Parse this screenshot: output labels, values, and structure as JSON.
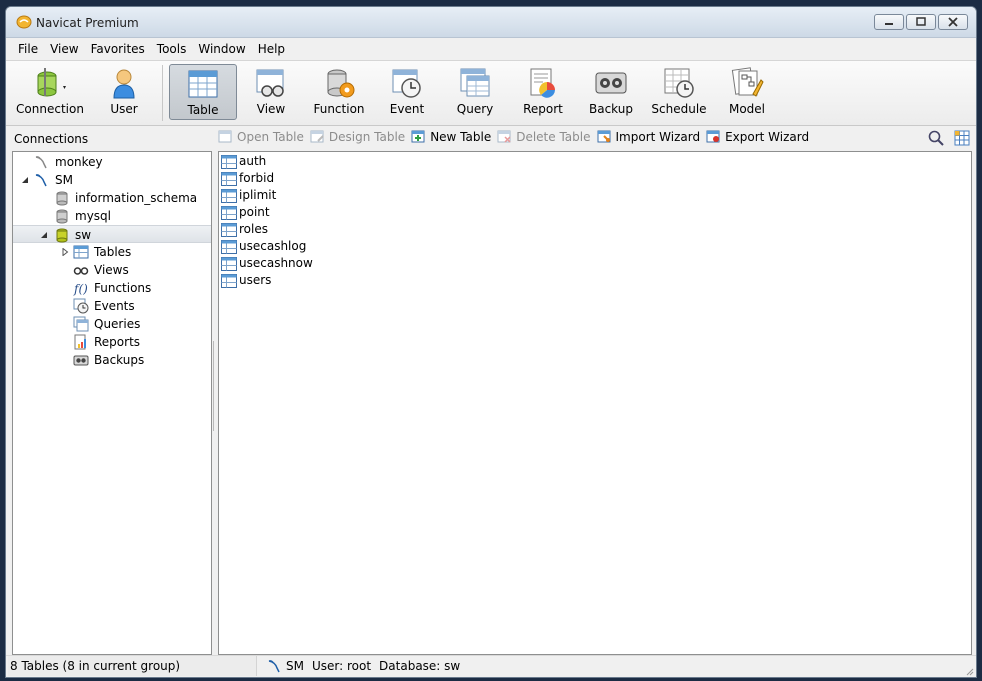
{
  "window": {
    "title": "Navicat Premium",
    "controls": [
      "minimize",
      "maximize",
      "close"
    ]
  },
  "menu": [
    "File",
    "View",
    "Favorites",
    "Tools",
    "Window",
    "Help"
  ],
  "toolbar": {
    "left": [
      {
        "label": "Connection",
        "icon": "connection-icon"
      },
      {
        "label": "User",
        "icon": "user-icon"
      }
    ],
    "main": [
      {
        "label": "Table",
        "icon": "table-icon",
        "active": true
      },
      {
        "label": "View",
        "icon": "view-icon"
      },
      {
        "label": "Function",
        "icon": "function-icon"
      },
      {
        "label": "Event",
        "icon": "event-icon"
      },
      {
        "label": "Query",
        "icon": "query-icon"
      },
      {
        "label": "Report",
        "icon": "report-icon"
      },
      {
        "label": "Backup",
        "icon": "backup-icon"
      },
      {
        "label": "Schedule",
        "icon": "schedule-icon"
      },
      {
        "label": "Model",
        "icon": "model-icon"
      }
    ]
  },
  "subbar": {
    "connections_label": "Connections",
    "actions": [
      {
        "label": "Open Table",
        "enabled": false
      },
      {
        "label": "Design Table",
        "enabled": false
      },
      {
        "label": "New Table",
        "enabled": true
      },
      {
        "label": "Delete Table",
        "enabled": false
      },
      {
        "label": "Import Wizard",
        "enabled": true
      },
      {
        "label": "Export Wizard",
        "enabled": true
      }
    ]
  },
  "tree": [
    {
      "label": "monkey",
      "type": "connection-closed",
      "level": 0
    },
    {
      "label": "SM",
      "type": "connection-open",
      "level": 0,
      "expanded": true
    },
    {
      "label": "information_schema",
      "type": "database",
      "level": 1
    },
    {
      "label": "mysql",
      "type": "database",
      "level": 1
    },
    {
      "label": "sw",
      "type": "database-open",
      "level": 1,
      "expanded": true,
      "selected": true
    },
    {
      "label": "Tables",
      "type": "tables",
      "level": 2,
      "collapsed": true
    },
    {
      "label": "Views",
      "type": "views",
      "level": 2
    },
    {
      "label": "Functions",
      "type": "functions",
      "level": 2
    },
    {
      "label": "Events",
      "type": "events",
      "level": 2
    },
    {
      "label": "Queries",
      "type": "queries",
      "level": 2
    },
    {
      "label": "Reports",
      "type": "reports",
      "level": 2
    },
    {
      "label": "Backups",
      "type": "backups",
      "level": 2
    }
  ],
  "tables": [
    "auth",
    "forbid",
    "iplimit",
    "point",
    "roles",
    "usecashlog",
    "usecashnow",
    "users"
  ],
  "status": {
    "left": "8 Tables (8 in current group)",
    "connection": "SM",
    "user": "User: root",
    "database": "Database: sw"
  },
  "colors": {
    "background": "#1c2c44",
    "window_bg": "#f0f0f0",
    "selected_db": "#c8d22a",
    "disabled_text": "#8c8c8c"
  }
}
